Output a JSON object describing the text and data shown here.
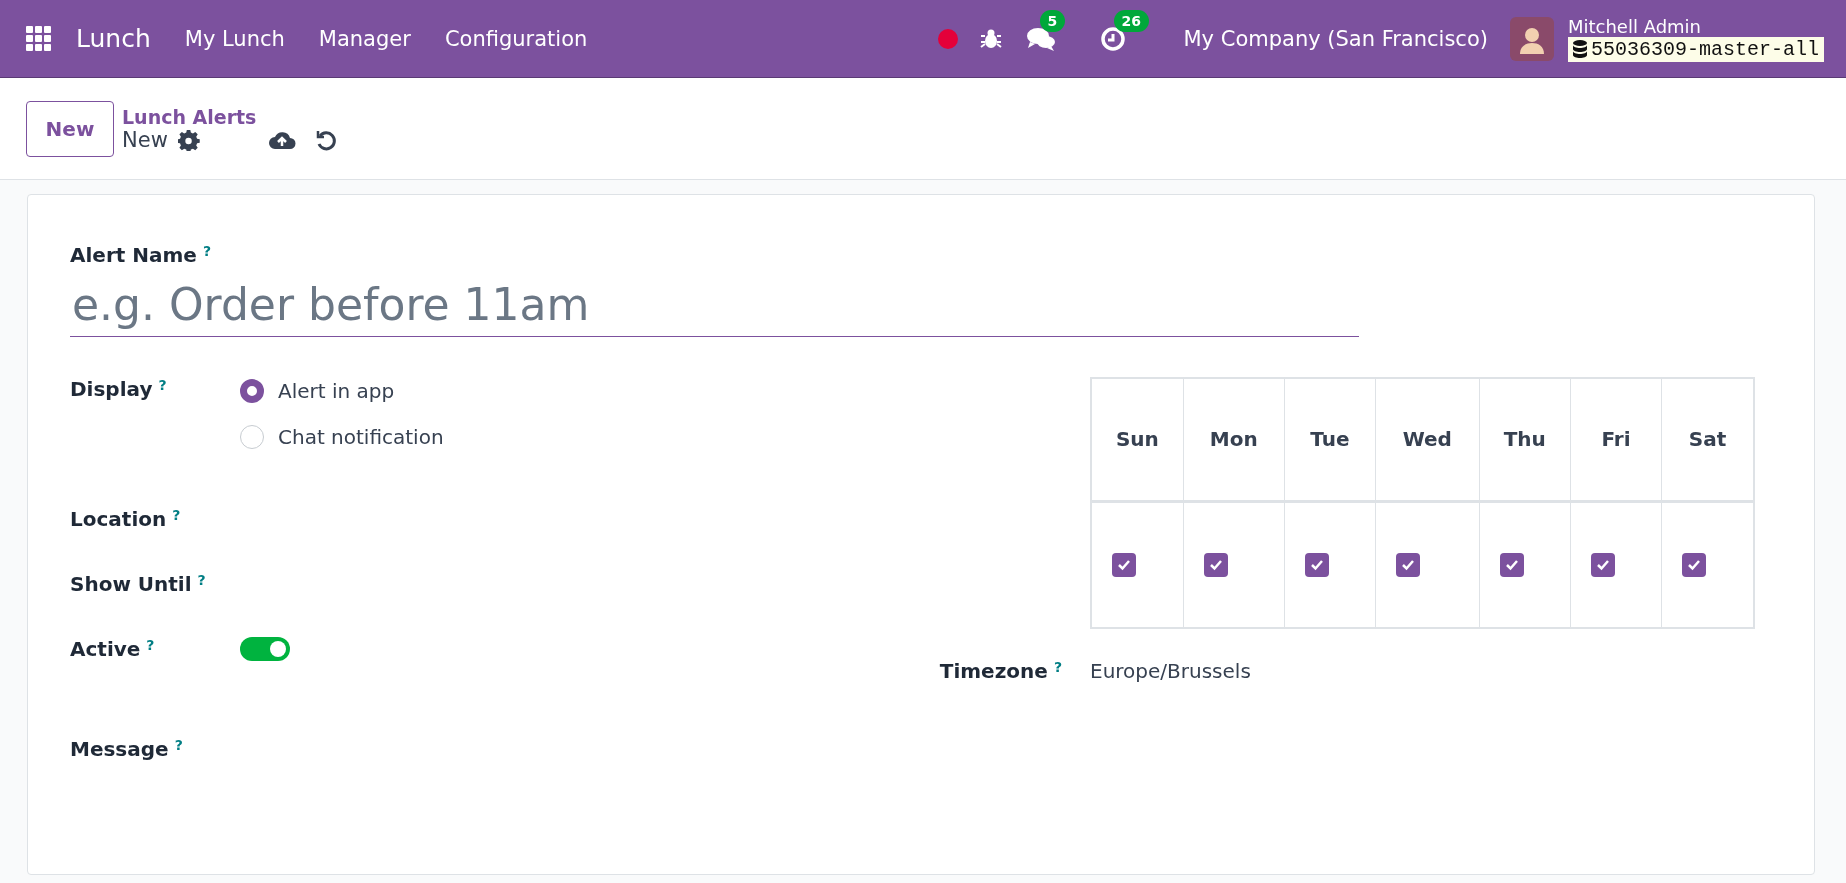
{
  "navbar": {
    "app_name": "Lunch",
    "menu": [
      "My Lunch",
      "Manager",
      "Configuration"
    ],
    "messages_count": "5",
    "activities_count": "26",
    "company": "My Company (San Francisco)",
    "user": "Mitchell Admin",
    "database": "55036309-master-all"
  },
  "control_panel": {
    "new_button": "New",
    "breadcrumb": "Lunch Alerts",
    "record": "New"
  },
  "form": {
    "alert_name": {
      "label": "Alert Name",
      "help": "?",
      "placeholder": "e.g. Order before 11am"
    },
    "display": {
      "label": "Display",
      "help": "?",
      "options": [
        {
          "label": "Alert in app",
          "selected": true
        },
        {
          "label": "Chat notification",
          "selected": false
        }
      ]
    },
    "location": {
      "label": "Location",
      "help": "?"
    },
    "show_until": {
      "label": "Show Until",
      "help": "?"
    },
    "active": {
      "label": "Active",
      "help": "?",
      "on": true
    },
    "message": {
      "label": "Message",
      "help": "?"
    },
    "days": [
      {
        "label": "Sun",
        "checked": true
      },
      {
        "label": "Mon",
        "checked": true
      },
      {
        "label": "Tue",
        "checked": true
      },
      {
        "label": "Wed",
        "checked": true
      },
      {
        "label": "Thu",
        "checked": true
      },
      {
        "label": "Fri",
        "checked": true
      },
      {
        "label": "Sat",
        "checked": true
      }
    ],
    "timezone": {
      "label": "Timezone",
      "help": "?",
      "value": "Europe/Brussels"
    }
  }
}
